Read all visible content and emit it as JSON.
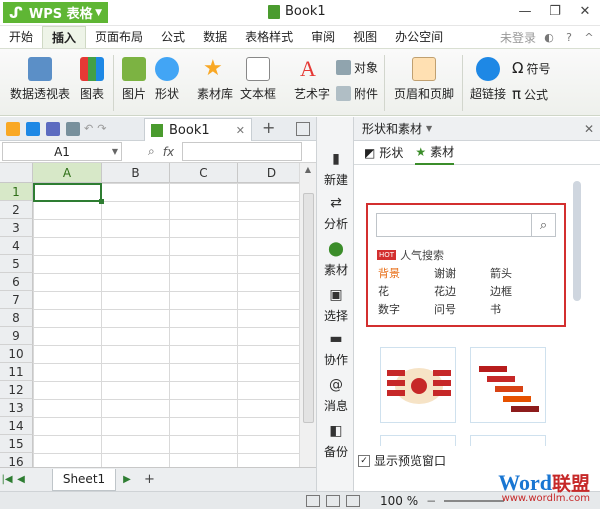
{
  "titlebar": {
    "app": "WPS 表格",
    "doc": "Book1"
  },
  "menu": {
    "tabs": [
      "开始",
      "插入",
      "页面布局",
      "公式",
      "数据",
      "表格样式",
      "审阅",
      "视图",
      "办公空间"
    ],
    "active_index": 1,
    "login": "未登录"
  },
  "ribbon": {
    "pivot": "数据透视表",
    "chart": "图表",
    "picture": "图片",
    "shapes": "形状",
    "library": "素材库",
    "textbox": "文本框",
    "wordart": "艺术字",
    "object": "对象",
    "attachment": "附件",
    "header_footer": "页眉和页脚",
    "hyperlink": "超链接",
    "symbol": "符号",
    "formula": "公式"
  },
  "doc": {
    "tab": "Book1"
  },
  "formula_bar": {
    "cell": "A1",
    "fx": "fx"
  },
  "sheet": {
    "columns": [
      "A",
      "B",
      "C",
      "D"
    ],
    "rows": [
      "1",
      "2",
      "3",
      "4",
      "5",
      "6",
      "7",
      "8",
      "9",
      "10",
      "11",
      "12",
      "13",
      "14",
      "15",
      "16"
    ],
    "tab": "Sheet1"
  },
  "side": {
    "new": "新建",
    "analyze": "分析",
    "material": "素材",
    "select": "选择",
    "collab": "协作",
    "message": "消息",
    "backup": "备份"
  },
  "panel": {
    "title": "形状和素材",
    "tab_shape": "形状",
    "tab_material": "素材",
    "hot_badge": "HOT",
    "hot_label": "人气搜索",
    "keywords": [
      "背景",
      "谢谢",
      "箭头",
      "花",
      "花边",
      "边框",
      "数字",
      "问号",
      "书"
    ],
    "checkbox": "显示预览窗口"
  },
  "status": {
    "zoom": "100 %"
  },
  "watermark": {
    "brand": "Word",
    "brand2": "联盟",
    "url": "www.wordlm.com"
  }
}
